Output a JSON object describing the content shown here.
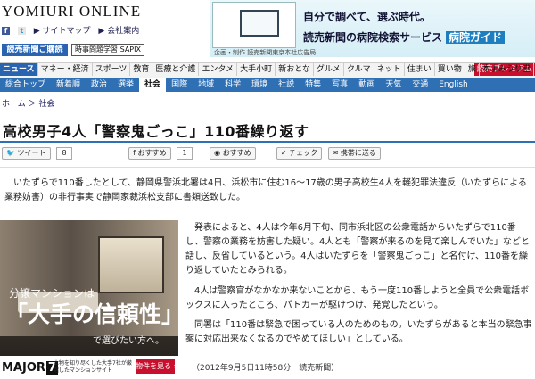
{
  "header": {
    "logo": "YOMIURI ONLINE",
    "sitemap": "▶ サイトマップ",
    "company": "▶ 会社案内",
    "subscribe_button": "読売新聞ご購読",
    "exam_button": "時事問題学習 SAPIX"
  },
  "banner": {
    "line1": "自分で調べて、選ぶ時代。",
    "line2": "読売新聞の病院検索サービス",
    "line2_highlight": "病院ガイド",
    "small": "企画・制作 読売新聞東京本社広告局"
  },
  "nav_top": [
    "ニュース",
    "マネー・経済",
    "スポーツ",
    "教育",
    "医療と介護",
    "エンタメ",
    "大手小町",
    "新おとな",
    "グルメ",
    "クルマ",
    "ネット",
    "住まい",
    "買い物",
    "旅",
    "本よみうり堂"
  ],
  "nav_premium": "読売プレミアム",
  "nav_sub": [
    "総合トップ",
    "新着順",
    "政治",
    "選挙",
    "社会",
    "国際",
    "地域",
    "科学",
    "環境",
    "社説",
    "特集",
    "写真",
    "動画",
    "天気",
    "交通",
    "English"
  ],
  "nav_sub_active": "社会",
  "breadcrumb": "ホーム ＞ 社会",
  "article": {
    "title": "高校男子4人「警察鬼ごっこ」110番繰り返す",
    "p1": "いたずらで110番したとして、静岡県警浜北署は4日、浜松市に住む16〜17歳の男子高校生4人を軽犯罪法違反（いたずらによる業務妨害）の非行事実で静岡家裁浜松支部に書類送致した。",
    "p2": "発表によると、4人は今年6月下旬、同市浜北区の公衆電話からいたずらで110番し、警察の業務を妨害した疑い。4人とも「警察が来るのを見て楽しんでいた」などと話し、反省しているという。4人はいたずらを「警察鬼ごっこ」と名付け、110番を繰り返していたとみられる。",
    "p3": "4人は警察官がなかなか来ないことから、もう一度110番しようと全員で公衆電話ボックスに入ったところ、パトカーが駆けつけ、発覚したという。",
    "p4": "同署は「110番は緊急で困っている人のためのもの。いたずらがあると本当の緊急事案に対応出来なくなるのでやめてほしい」としている。",
    "dateline": "（2012年9月5日11時58分　読売新聞）"
  },
  "social": {
    "tweet": "ツイート",
    "tweet_count": "8",
    "recommend": "おすすめ",
    "recommend_count": "1",
    "recommend2": "おすすめ",
    "check": "チェック",
    "mobile": "携帯に送る"
  },
  "ad": {
    "line1": "分譲マンションは",
    "line2": "「大手の信頼性」",
    "line3": "で選びたい方へ。",
    "brand": "MAJOR",
    "brand_num": "7",
    "small": "本物を知り尽くした大手7社が厳選したマンションサイト",
    "cta": "物件を見る ›"
  }
}
